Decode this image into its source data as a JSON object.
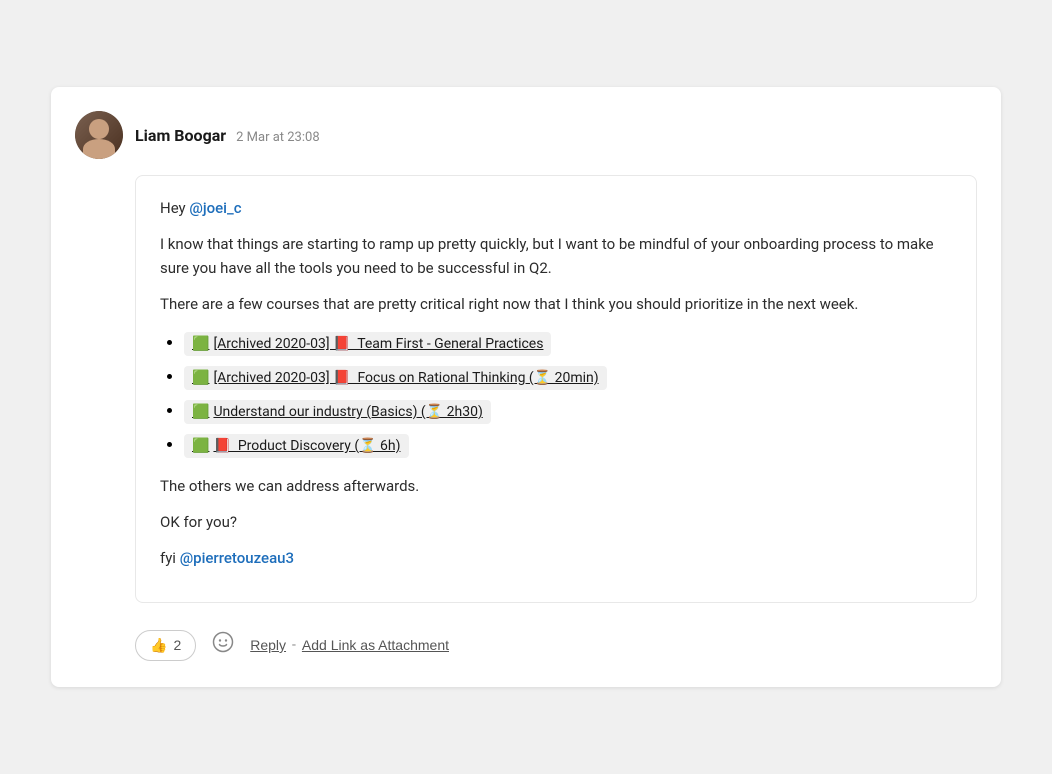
{
  "message": {
    "author": "Liam Boogar",
    "timestamp": "2 Mar at 23:08",
    "greeting": "Hey ",
    "mention1": "@joei_c",
    "body1": "I know that things are starting to ramp up pretty quickly, but I want to be mindful of your onboarding process to make sure you have all the tools you need to be successful in Q2.",
    "body2": "There are a few courses that are pretty critical right now that I think you should prioritize in the next week.",
    "courses": [
      {
        "icon1": "🟩",
        "icon2": "📕",
        "text": "[Archived 2020-03]📕  Team First - General Practices"
      },
      {
        "icon1": "🟩",
        "icon2": "📕",
        "text": "[Archived 2020-03]📕  Focus on Rational Thinking (⏳ 20min)"
      },
      {
        "icon1": "🟩",
        "text": "Understand our industry (Basics) (⏳ 2h30)"
      },
      {
        "icon1": "🟩",
        "icon2": "📕",
        "text": "📕  Product Discovery (⏳ 6h)"
      }
    ],
    "body3": "The others we can address afterwards.",
    "body4": "OK for you?",
    "body5_prefix": "fyi ",
    "mention2": "@pierretouzeau3",
    "reaction_emoji": "👍",
    "reaction_count": "2",
    "reply_label": "Reply",
    "separator": "-",
    "add_link_label": "Add Link as Attachment"
  }
}
